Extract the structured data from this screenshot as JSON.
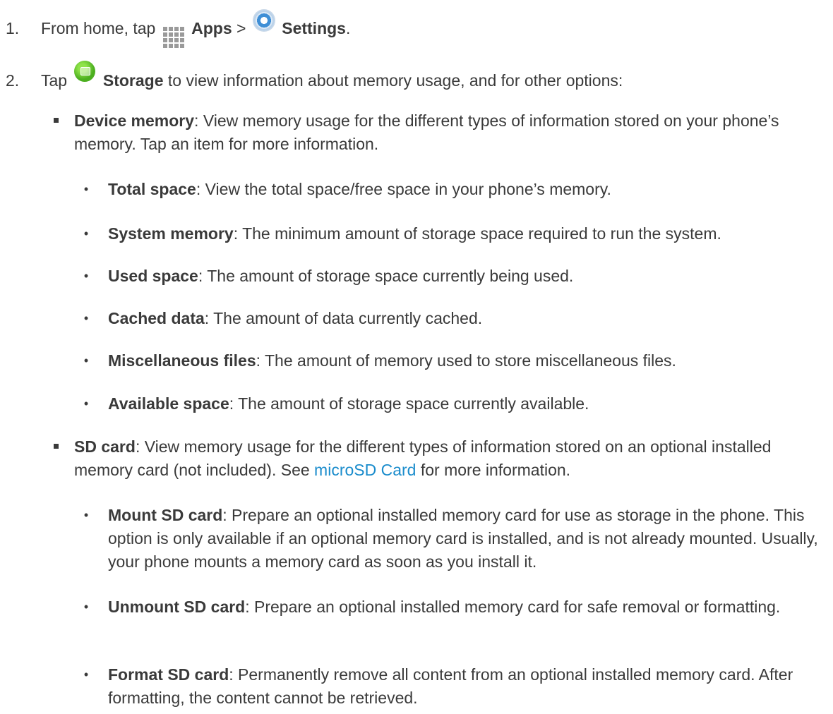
{
  "steps": [
    {
      "num": "1.",
      "parts": {
        "prefix": "From home, tap",
        "apps_label": "Apps",
        "separator": ">",
        "settings_label": "Settings",
        "suffix": "."
      }
    },
    {
      "num": "2.",
      "parts": {
        "prefix": "Tap",
        "storage_label": "Storage",
        "suffix": " to view information about memory usage, and for other options:"
      }
    }
  ],
  "device_memory": {
    "term": "Device memory",
    "desc": ": View memory usage for the different types of information stored on your phone’s memory. Tap an item for more information.",
    "items": [
      {
        "term": "Total space",
        "desc": ": View the total space/free space in your phone’s memory."
      },
      {
        "term": "System memory",
        "desc": ": The minimum amount of storage space required to run the system."
      },
      {
        "term": "Used space",
        "desc": ": The amount of storage space currently being used."
      },
      {
        "term": "Cached data",
        "desc": ": The amount of data currently cached."
      },
      {
        "term": "Miscellaneous files",
        "desc": ": The amount of memory used to store miscellaneous files."
      },
      {
        "term": "Available space",
        "desc": ": The amount of storage space currently available."
      }
    ]
  },
  "sd_card": {
    "term": "SD card",
    "desc_before": ": View memory usage for the different types of information stored on an optional installed memory card (not included). See ",
    "link": "microSD Card",
    "desc_after": " for more information.",
    "items": [
      {
        "term": "Mount SD card",
        "desc": ": Prepare an optional installed memory card for use as storage in the phone. This option is only available if an optional memory card is installed, and is not already mounted. Usually, your phone mounts a memory card as soon as you install it."
      },
      {
        "term": "Unmount SD card",
        "desc": ": Prepare an optional installed memory card for safe removal or formatting."
      },
      {
        "term": "Format SD card",
        "desc": ": Permanently remove all content from an optional installed memory card. After formatting, the content cannot be retrieved."
      }
    ]
  },
  "bullet_glyph": "•",
  "icons": [
    "apps-grid-icon",
    "settings-icon",
    "storage-icon"
  ],
  "colors": {
    "text": "#3a3a3a",
    "link": "#1a8ccc"
  }
}
